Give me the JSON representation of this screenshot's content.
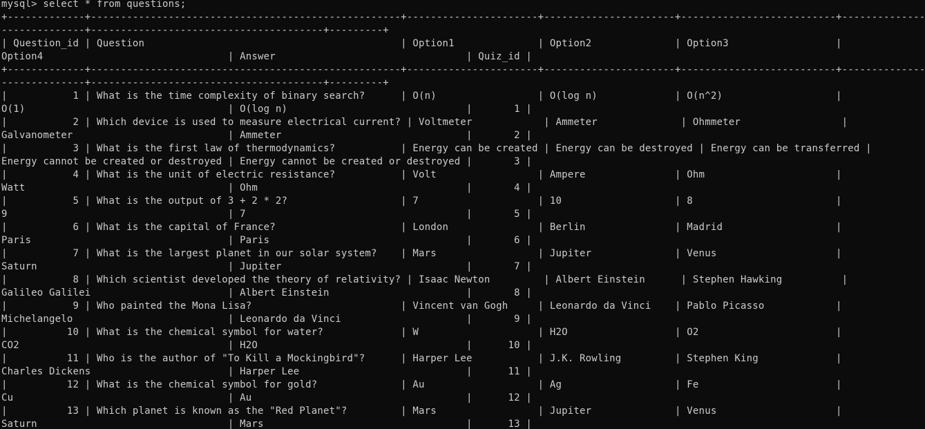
{
  "terminal": {
    "background": "#0c0c0c",
    "foreground": "#cccccc",
    "lines": [
      "mysql> select * from questions;",
      "+-------------+----------------------------------------------------+----------------------+----------------------+--------------------------+----------------------------",
      "--------------+---------------------------------------+---------+",
      "| Question_id | Question                                           | Option1              | Option2              | Option3                  |",
      "Option4                               | Answer                                | Quiz_id |",
      "+-------------+----------------------------------------------------+----------------------+----------------------+--------------------------+----------------------------",
      "--------------+---------------------------------------+---------+",
      "|           1 | What is the time complexity of binary search?      | O(n)                 | O(log n)             | O(n^2)                   |",
      "O(1)                                  | O(log n)                              |       1 |",
      "|           2 | Which device is used to measure electrical current? | Voltmeter            | Ammeter              | Ohmmeter                 |",
      "Galvanometer                          | Ammeter                               |       2 |",
      "|           3 | What is the first law of thermodynamics?           | Energy can be created | Energy can be destroyed | Energy can be transferred |",
      "Energy cannot be created or destroyed | Energy cannot be created or destroyed |       3 |",
      "|           4 | What is the unit of electric resistance?           | Volt                 | Ampere               | Ohm                      |",
      "Watt                                  | Ohm                                   |       4 |",
      "|           5 | What is the output of 3 + 2 * 2?                   | 7                    | 10                   | 8                        |",
      "9                                     | 7                                     |       5 |",
      "|           6 | What is the capital of France?                     | London               | Berlin               | Madrid                   |",
      "Paris                                 | Paris                                 |       6 |",
      "|           7 | What is the largest planet in our solar system?    | Mars                 | Jupiter              | Venus                    |",
      "Saturn                                | Jupiter                               |       7 |",
      "|           8 | Which scientist developed the theory of relativity? | Isaac Newton         | Albert Einstein      | Stephen Hawking          |",
      "Galileo Galilei                       | Albert Einstein                       |       8 |",
      "|           9 | Who painted the Mona Lisa?                         | Vincent van Gogh     | Leonardo da Vinci    | Pablo Picasso            |",
      "Michelangelo                          | Leonardo da Vinci                     |       9 |",
      "|          10 | What is the chemical symbol for water?             | W                    | H2O                  | O2                       |",
      "CO2                                   | H2O                                   |      10 |",
      "|          11 | Who is the author of \"To Kill a Mockingbird\"?      | Harper Lee           | J.K. Rowling         | Stephen King             |",
      "Charles Dickens                       | Harper Lee                            |      11 |",
      "|          12 | What is the chemical symbol for gold?              | Au                   | Ag                   | Fe                       |",
      "Cu                                    | Au                                    |      12 |",
      "|          13 | Which planet is known as the \"Red Planet\"?         | Mars                 | Jupiter              | Venus                    |",
      "Saturn                                | Mars                                  |      13 |"
    ]
  }
}
